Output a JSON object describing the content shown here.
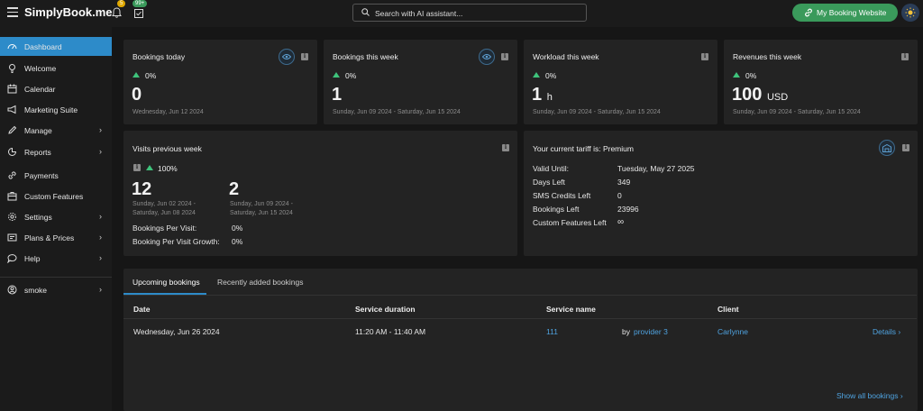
{
  "app": {
    "logo": "SimplyBook.me"
  },
  "header": {
    "notif_badge": "5",
    "tasks_badge": "99+",
    "search_placeholder": "Search with AI assistant...",
    "booking_site_label": "My Booking Website",
    "notif_badge_color": "#e0a800",
    "tasks_badge_color": "#3a9a5b"
  },
  "sidebar": {
    "items": [
      {
        "label": "Dashboard",
        "icon": "dashboard-icon",
        "active": true
      },
      {
        "label": "Welcome",
        "icon": "lightbulb-icon"
      },
      {
        "label": "Calendar",
        "icon": "calendar-icon"
      },
      {
        "label": "Marketing Suite",
        "icon": "megaphone-icon"
      },
      {
        "label": "Manage",
        "icon": "pencil-icon",
        "chevron": true
      },
      {
        "label": "Reports",
        "icon": "chart-icon",
        "chevron": true
      },
      {
        "label": "Payments",
        "icon": "link-icon"
      },
      {
        "label": "Custom Features",
        "icon": "box-icon"
      },
      {
        "label": "Settings",
        "icon": "gear-icon",
        "chevron": true
      },
      {
        "label": "Plans & Prices",
        "icon": "plans-icon",
        "chevron": true
      },
      {
        "label": "Help",
        "icon": "chat-icon",
        "chevron": true
      }
    ],
    "user": {
      "label": "smoke",
      "icon": "user-icon"
    }
  },
  "stats": {
    "bookings_today": {
      "title": "Bookings today",
      "pct": "0%",
      "value": "0",
      "date": "Wednesday, Jun 12 2024"
    },
    "bookings_week": {
      "title": "Bookings this week",
      "pct": "0%",
      "value": "1",
      "date": "Sunday, Jun 09 2024 - Saturday, Jun 15 2024"
    },
    "workload_week": {
      "title": "Workload this week",
      "pct": "0%",
      "value": "1",
      "unit": "h",
      "date": "Sunday, Jun 09 2024 - Saturday, Jun 15 2024"
    },
    "revenues_week": {
      "title": "Revenues this week",
      "pct": "0%",
      "value": "100",
      "unit": "USD",
      "date": "Sunday, Jun 09 2024 - Saturday, Jun 15 2024"
    }
  },
  "visits": {
    "title": "Visits previous week",
    "pct": "100%",
    "prev_value": "12",
    "prev_date_1": "Sunday, Jun 02 2024 -",
    "prev_date_2": "Saturday, Jun 08 2024",
    "cur_value": "2",
    "cur_date_1": "Sunday, Jun 09 2024 -",
    "cur_date_2": "Saturday, Jun 15 2024",
    "per_visit_label": "Bookings Per Visit:",
    "per_visit_value": "0%",
    "growth_label": "Booking Per Visit Growth:",
    "growth_value": "0%"
  },
  "tariff": {
    "title": "Your current tariff is: Premium",
    "rows": [
      {
        "label": "Valid Until:",
        "value": "Tuesday, May 27 2025"
      },
      {
        "label": "Days Left",
        "value": "349"
      },
      {
        "label": "SMS Credits Left",
        "value": "0"
      },
      {
        "label": "Bookings Left",
        "value": "23996"
      },
      {
        "label": "Custom Features Left",
        "value": "∞"
      }
    ]
  },
  "bookings": {
    "tabs": [
      "Upcoming bookings",
      "Recently added bookings"
    ],
    "columns": [
      "Date",
      "Service duration",
      "Service name",
      "Client"
    ],
    "rows": [
      {
        "date": "Wednesday, Jun 26 2024",
        "duration": "11:20 AM - 11:40 AM",
        "service": "111",
        "by": "by",
        "provider": "provider 3",
        "client": "Carlynne",
        "details": "Details"
      }
    ],
    "show_all": "Show all bookings"
  },
  "colors": {
    "accent": "#2d8bc9",
    "success": "#3ec37b",
    "link": "#4fa3e0",
    "button": "#3a9a5b"
  }
}
